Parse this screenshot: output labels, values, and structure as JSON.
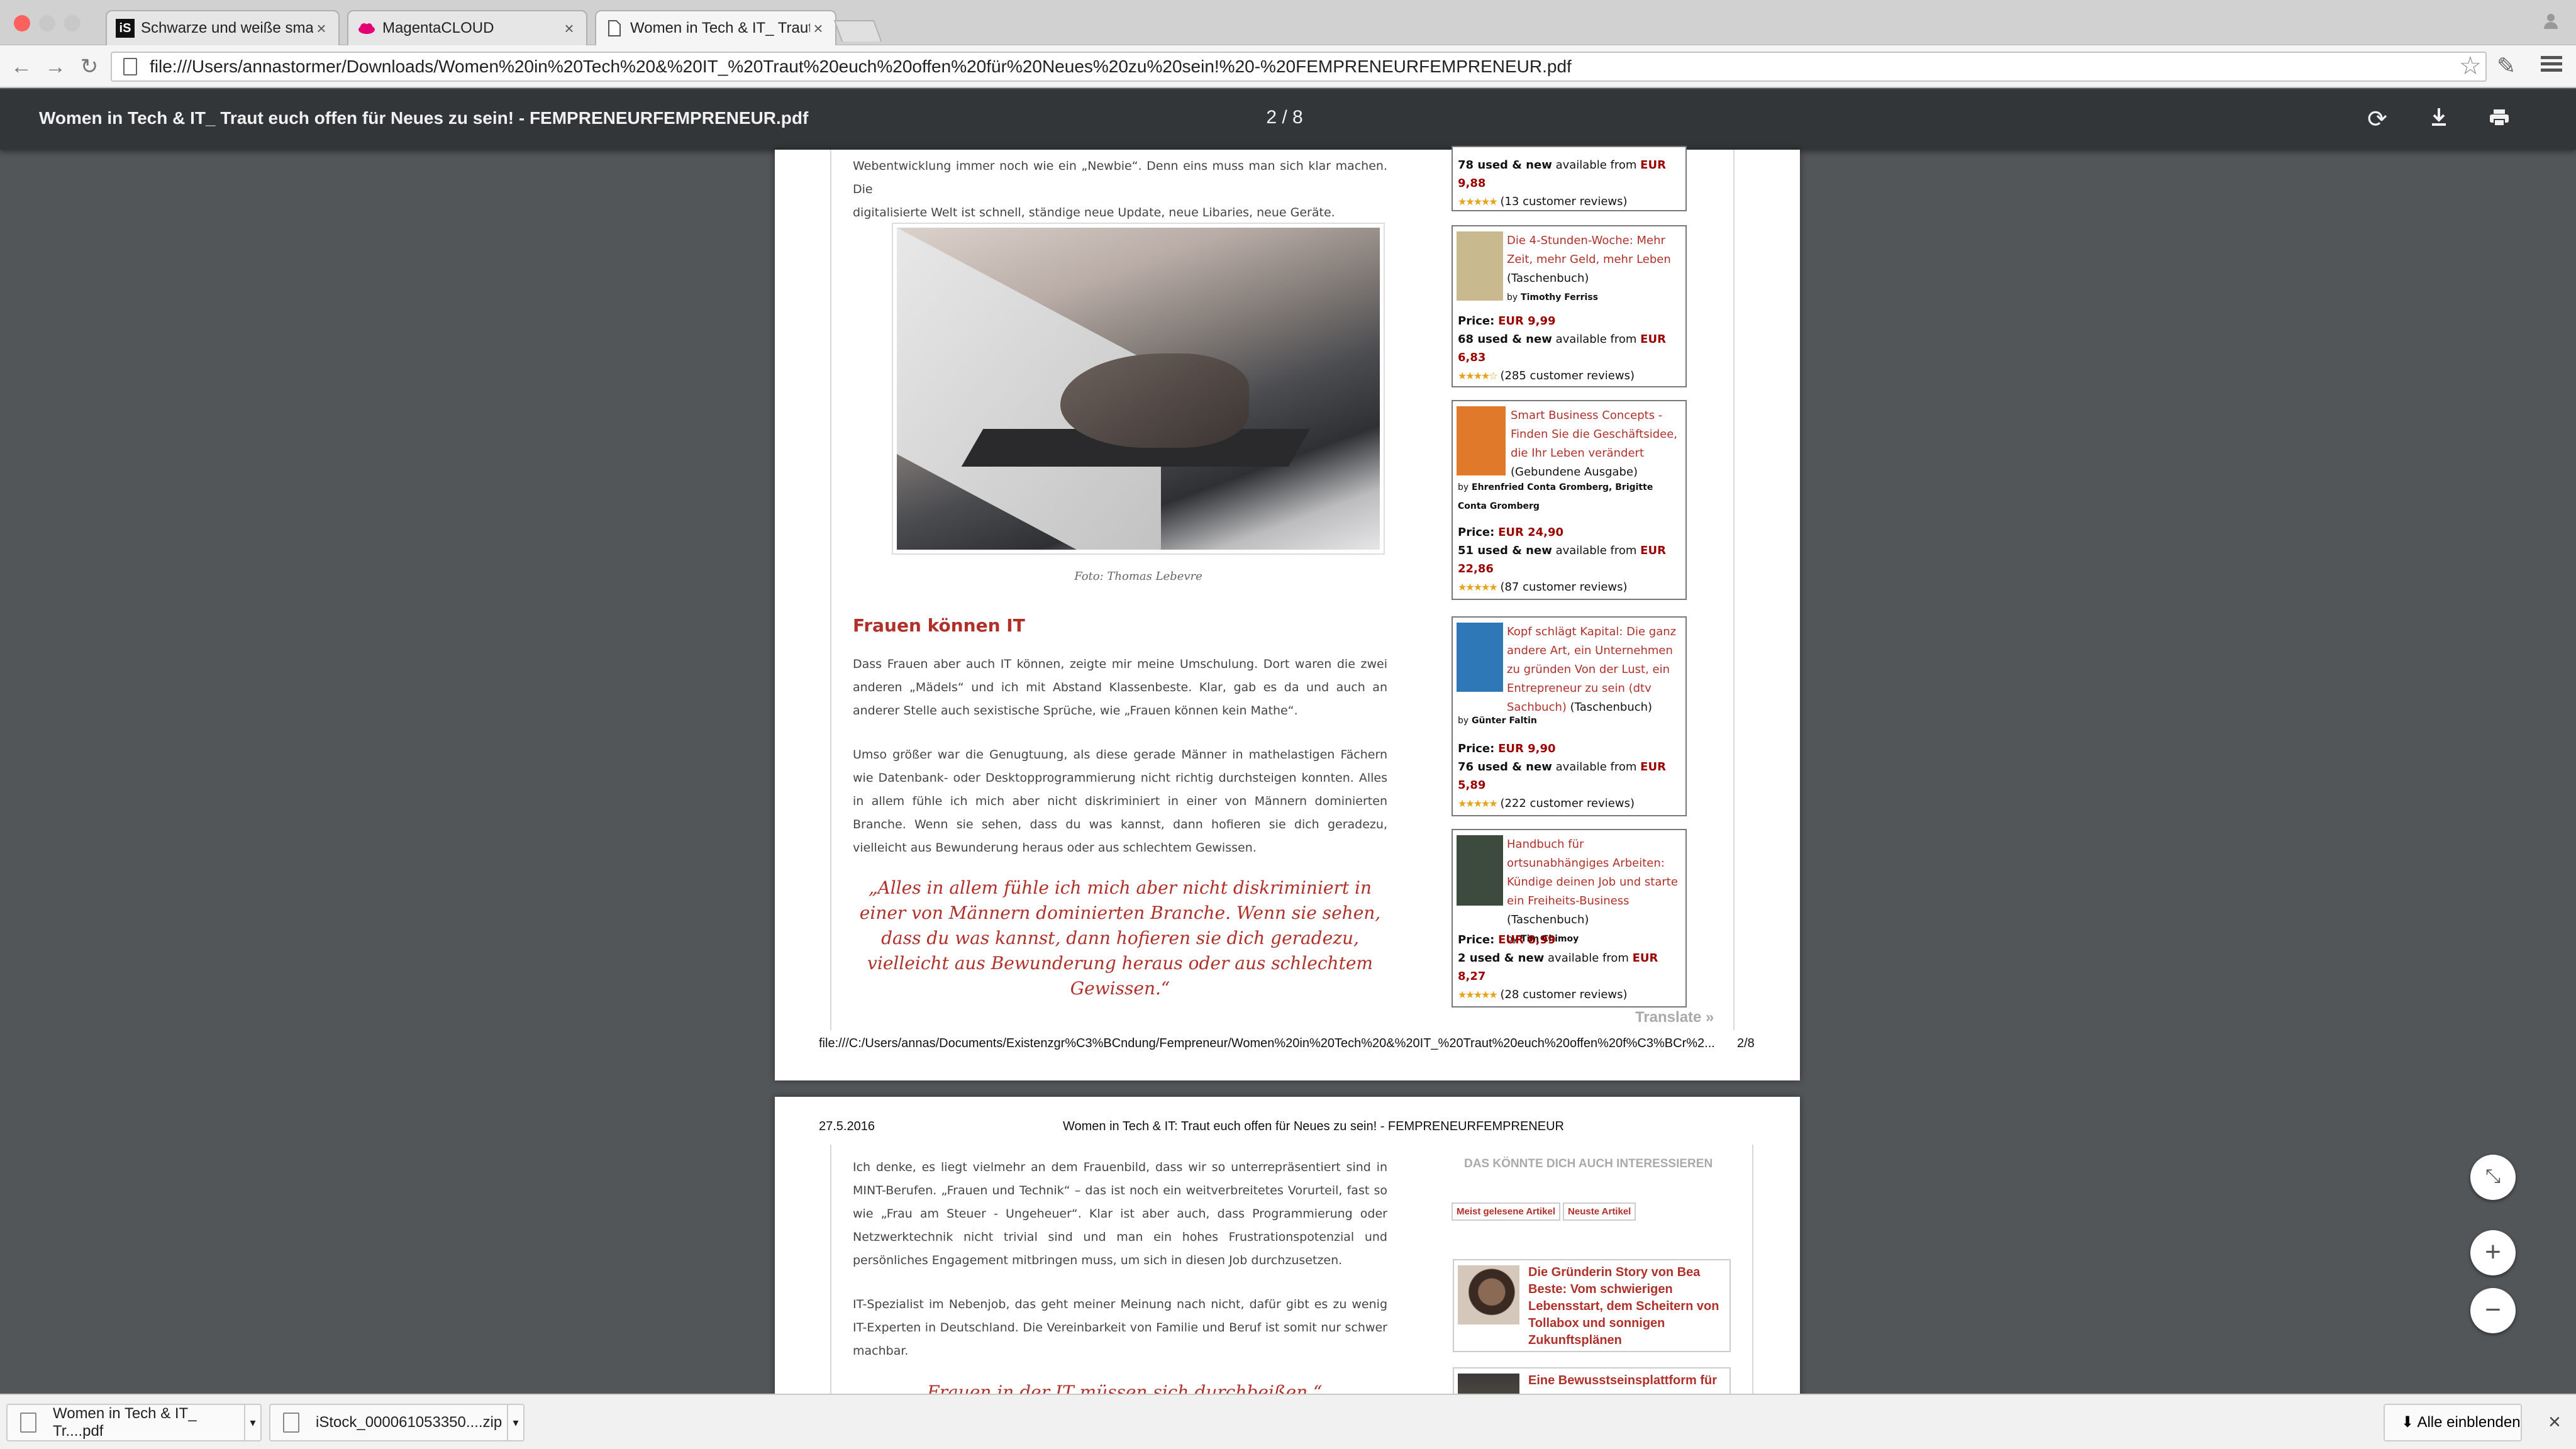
{
  "browser": {
    "tabs": [
      {
        "title": "Schwarze und weiße smart",
        "favicon": "iS"
      },
      {
        "title": "MagentaCLOUD",
        "favicon": "magenta-cloud"
      },
      {
        "title": "Women in Tech & IT_ Traut",
        "favicon": "document"
      }
    ],
    "tab_close": "×",
    "address": "file:///Users/annastormer/Downloads/Women%20in%20Tech%20&%20IT_%20Traut%20euch%20offen%20für%20Neues%20zu%20sein!%20-%20FEMPRENEURFEMPRENEUR.pdf"
  },
  "pdf_viewer": {
    "title": "Women in Tech & IT_ Traut euch offen für Neues zu sein! - FEMPRENEURFEMPRENEUR.pdf",
    "current_page": "2",
    "separator": "/",
    "total_pages": "8"
  },
  "page1": {
    "intro_lines": [
      "Webentwicklung immer noch wie ein „Newbie“. Denn eins muss man sich klar machen. Die",
      "digitalisierte Welt ist schnell, ständige neue Update, neue Libaries, neue Geräte."
    ],
    "photo_caption": "Foto: Thomas Lebevre",
    "heading": "Frauen können IT",
    "paragraph1": "Dass Frauen aber auch IT können, zeigte mir meine Umschulung. Dort waren die zwei anderen „Mädels“ und ich mit Abstand Klassenbeste. Klar, gab es da und auch an anderer Stelle auch sexistische Sprüche, wie „Frauen können kein Mathe“.",
    "paragraph2": "Umso größer war die Genugtuung, als diese gerade Männer in mathelastigen Fächern wie Datenbank- oder Desktopprogrammierung nicht richtig durchsteigen konnten. Alles in allem fühle ich mich aber nicht diskriminiert in einer von Männern dominierten Branche. Wenn sie sehen, dass du was kannst, dann hofieren sie dich geradezu, vielleicht aus Bewunderung heraus oder aus schlechtem Gewissen.",
    "pullquote": "„Alles in allem fühle ich mich aber nicht diskriminiert in einer von Männern dominierten Branche. Wenn sie sehen, dass du was kannst, dann hofieren sie dich geradezu, vielleicht aus Bewunderung heraus oder aus schlechtem Gewissen.“",
    "sidebar_top": {
      "used_count": "78 used & new",
      "available_text": "available from",
      "used_price": "EUR 9,88",
      "reviews": "(13 customer reviews)"
    },
    "books": [
      {
        "title": "Die 4-Stunden-Woche: Mehr Zeit, mehr Geld, mehr Leben",
        "format": "(Taschenbuch)",
        "by": "by",
        "author": "Timothy Ferriss",
        "price_label": "Price:",
        "price": "EUR 9,99",
        "used_count": "68 used & new",
        "available_text": "available from",
        "used_price": "EUR 6,83",
        "reviews": "(285 customer reviews)",
        "cover_color": "#c9b98e"
      },
      {
        "title": "Smart Business Concepts - Finden Sie die Geschäftsidee, die Ihr Leben verändert",
        "format": "(Gebundene Ausgabe)",
        "by": "by",
        "author": "Ehrenfried Conta Gromberg, Brigitte Conta Gromberg",
        "price_label": "Price:",
        "price": "EUR 24,90",
        "used_count": "51 used & new",
        "available_text": "available from",
        "used_price": "EUR 22,86",
        "reviews": "(87 customer reviews)",
        "cover_color": "#e07a2a"
      },
      {
        "title": "Kopf schlägt Kapital: Die ganz andere Art, ein Unternehmen zu gründen Von der Lust, ein Entrepreneur zu sein (dtv Sachbuch)",
        "format": "(Taschenbuch)",
        "by": "by",
        "author": "Günter Faltin",
        "price_label": "Price:",
        "price": "EUR 9,90",
        "used_count": "76 used & new",
        "available_text": "available from",
        "used_price": "EUR 5,89",
        "reviews": "(222 customer reviews)",
        "cover_color": "#2f78b8"
      },
      {
        "title": "Handbuch für ortsunabhängiges Arbeiten: Kündige deinen Job und starte ein Freiheits-Business",
        "format": "(Taschenbuch)",
        "by": "by",
        "author": "Tim Chimoy",
        "price_label": "Price:",
        "price": "EUR 8,99",
        "used_count": "2 used & new",
        "available_text": "available from",
        "used_price": "EUR 8,27",
        "reviews": "(28 customer reviews)",
        "cover_color": "#3d4a3e"
      }
    ],
    "translate": "Translate »",
    "footer_url": "file:///C:/Users/annas/Documents/Existenzgr%C3%BCndung/Fempreneur/Women%20in%20Tech%20&%20IT_%20Traut%20euch%20offen%20f%C3%BCr%2...",
    "footer_page": "2/8"
  },
  "page2": {
    "date": "27.5.2016",
    "header_title": "Women in Tech & IT: Traut euch offen für Neues zu sein! - FEMPRENEURFEMPRENEUR",
    "paragraph1": "Ich denke, es liegt vielmehr an dem Frauenbild, dass wir so unterrepräsentiert sind in MINT-Berufen. „Frauen und Technik“ – das ist noch ein weitverbreitetes Vorurteil, fast so wie „Frau am Steuer - Ungeheuer“. Klar ist aber auch, dass Programmierung oder Netzwerktechnik nicht trivial sind und man ein hohes Frustrationspotenzial und persönliches Engagement mitbringen muss, um sich in diesen Job durchzusetzen.",
    "paragraph2": "IT-Spezialist im Nebenjob, das geht meiner Meinung nach nicht, dafür gibt es zu wenig IT-Experten in Deutschland. Die Vereinbarkeit von Familie und Beruf ist somit nur schwer machbar.",
    "quote_partial": "„Frauen in der IT müssen sich durchbeißen.“",
    "side_heading": "DAS KÖNNTE DICH AUCH INTERESSIEREN",
    "side_tabs": [
      "Meist gelesene Artikel",
      "Neuste Artikel"
    ],
    "related": [
      {
        "title": "Die Gründerin Story von Bea Beste: Vom schwierigen Lebensstart, dem Scheitern von Tollabox und sonnigen Zukunftsplänen"
      },
      {
        "title": "Eine Bewusstseinsplattform für"
      }
    ]
  },
  "zoom": {
    "fit": "⤡",
    "in": "+",
    "out": "−"
  },
  "downloads": {
    "items": [
      {
        "name": "Women in Tech & IT_ Tr....pdf"
      },
      {
        "name": "iStock_000061053350....zip"
      }
    ],
    "show_all": "Alle einblenden",
    "close": "×"
  }
}
